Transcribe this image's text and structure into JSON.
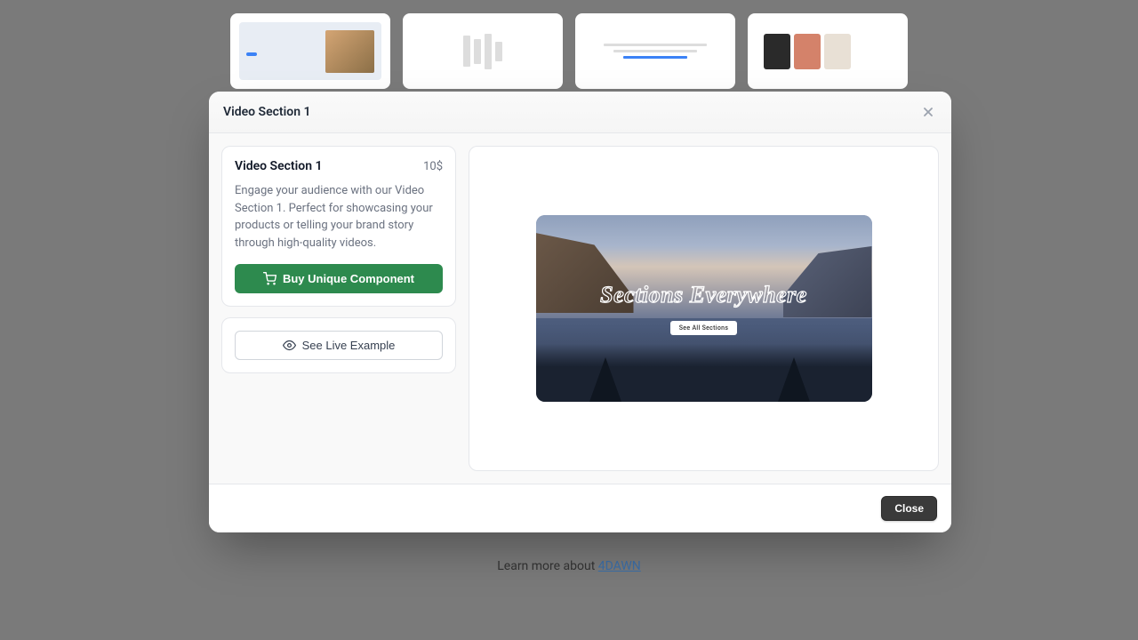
{
  "modal": {
    "header_title": "Video Section 1",
    "close_label": "Close"
  },
  "product": {
    "title": "Video Section 1",
    "price": "10$",
    "description": "Engage your audience with our Video Section 1. Perfect for showcasing your products or telling your brand story through high-quality videos.",
    "buy_label": "Buy Unique Component",
    "see_live_label": "See Live Example"
  },
  "preview": {
    "hero_text": "Sections Everywhere",
    "cta_label": "See All Sections"
  },
  "footer": {
    "text_prefix": "Learn more about ",
    "link_label": "4DAWN"
  }
}
